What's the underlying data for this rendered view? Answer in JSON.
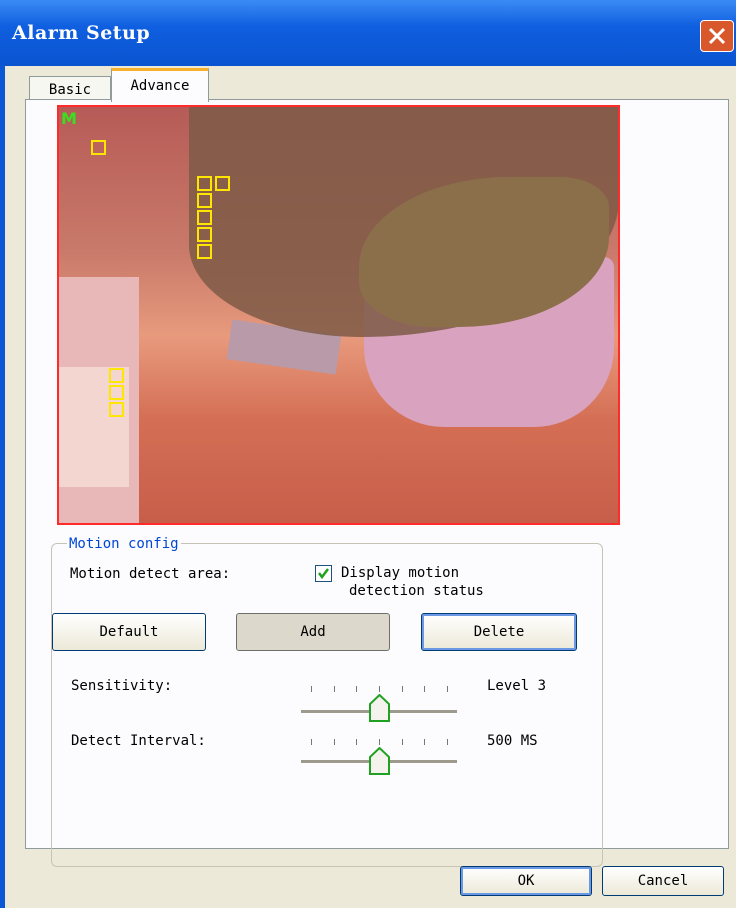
{
  "window": {
    "title": "Alarm Setup"
  },
  "tabs": [
    {
      "label": "Basic",
      "active": false
    },
    {
      "label": "Advance",
      "active": true
    }
  ],
  "video": {
    "overlay_label": "M"
  },
  "motion_config": {
    "group_title": "Motion config",
    "detect_area_label": "Motion detect area:",
    "display_status_checkbox": {
      "checked": true,
      "label_line1": "Display motion",
      "label_line2": "detection status"
    },
    "buttons": {
      "default": "Default",
      "add": "Add",
      "delete": "Delete"
    },
    "sensitivity": {
      "label": "Sensitivity:",
      "value_text": "Level 3",
      "level": 3,
      "max_level": 6
    },
    "detect_interval": {
      "label": "Detect Interval:",
      "value_text": "500 MS",
      "level": 3,
      "max_level": 6
    }
  },
  "dialog_buttons": {
    "ok": "OK",
    "cancel": "Cancel"
  },
  "colors": {
    "accent_tab": "#f7b12d",
    "group_title": "#0046d5",
    "motion_box": "#ffe600",
    "video_border": "#ff2a2a",
    "overlay_label": "#39e020"
  }
}
